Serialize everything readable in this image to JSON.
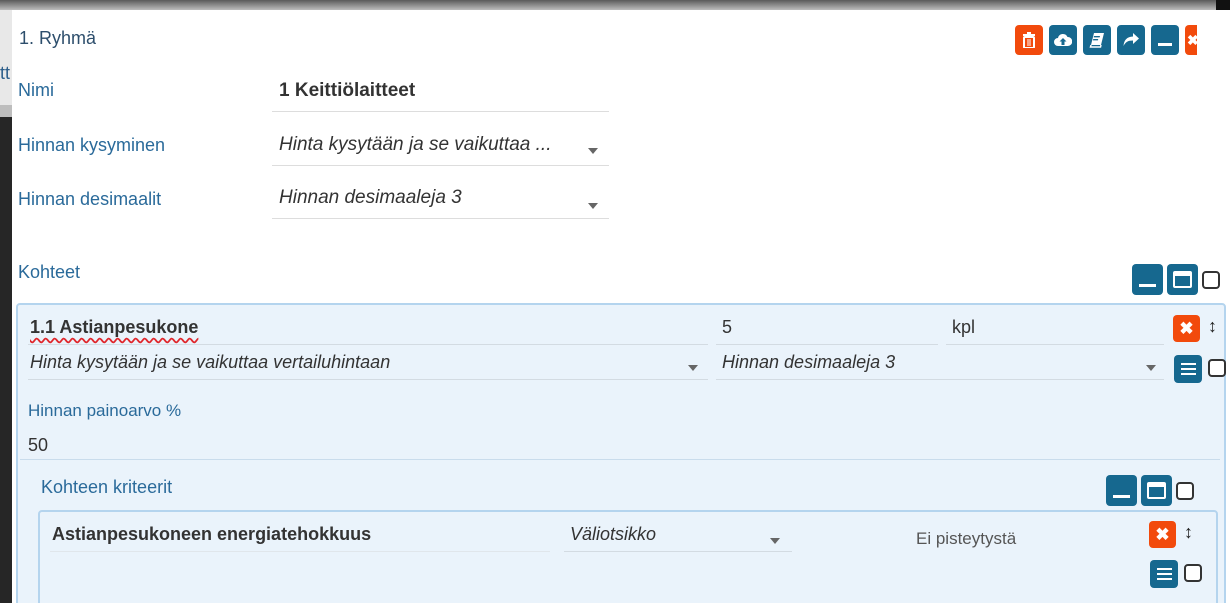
{
  "group": {
    "title": "1. Ryhmä",
    "clipped_behind_text": "tt"
  },
  "toolbar": {
    "delete_icon": "trash-icon",
    "upload_icon": "cloud-upload-icon",
    "book_icon": "book-icon",
    "share_icon": "share-arrow-icon",
    "minimize_icon": "minimize-icon",
    "close_icon": "close-icon"
  },
  "form": {
    "name_label": "Nimi",
    "name_value": "1 Keittiölaitteet",
    "price_query_label": "Hinnan kysyminen",
    "price_query_value": "Hinta kysytään ja se vaikuttaa ...",
    "price_decimals_label": "Hinnan desimaalit",
    "price_decimals_value": "Hinnan desimaaleja 3"
  },
  "targets": {
    "title": "Kohteet",
    "item": {
      "name": "1.1 Astianpesukone",
      "quantity": "5",
      "unit": "kpl",
      "price_query_value": "Hinta kysytään ja se vaikuttaa vertailuhintaan",
      "price_decimals_value": "Hinnan desimaaleja 3",
      "weight_label": "Hinnan painoarvo %",
      "weight_value": "50"
    }
  },
  "criteria": {
    "title": "Kohteen kriteerit",
    "item": {
      "name": "Astianpesukoneen energiatehokkuus",
      "type_value": "Väliotsikko",
      "scoring": "Ei pisteytystä"
    }
  },
  "colors": {
    "danger": "#f24a0c",
    "primary": "#16688f",
    "label": "#2a6a9a",
    "panel_bg": "#eaf3fb"
  }
}
